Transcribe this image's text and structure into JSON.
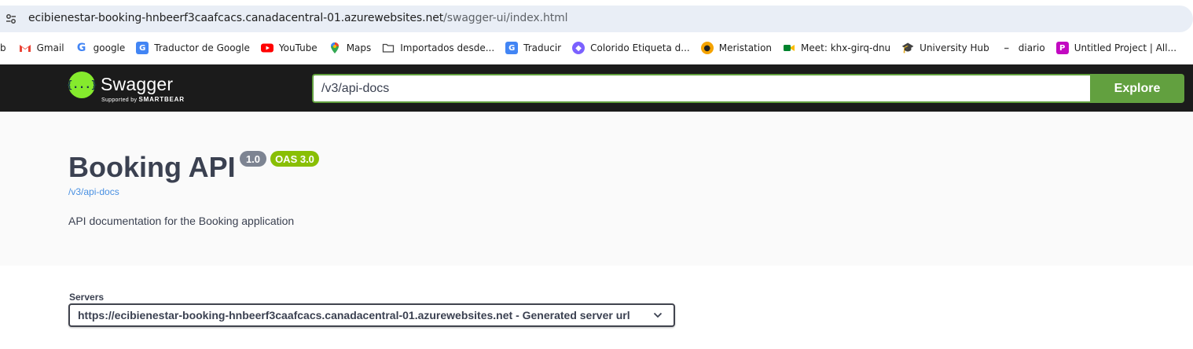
{
  "browser": {
    "url_host": "ecibienestar-booking-hnbeerf3caafcacs.canadacentral-01.azurewebsites.net",
    "url_path": "/swagger-ui/index.html"
  },
  "bookmarks": [
    {
      "label": "b",
      "icon": "truncated"
    },
    {
      "label": "Gmail",
      "icon": "gmail-icon",
      "color": "#ea4335"
    },
    {
      "label": "google",
      "icon": "google-icon",
      "color": "#4285f4"
    },
    {
      "label": "Traductor de Google",
      "icon": "google-translate-icon",
      "color": "#4285f4"
    },
    {
      "label": "YouTube",
      "icon": "youtube-icon",
      "color": "#ff0000"
    },
    {
      "label": "Maps",
      "icon": "maps-pin-icon",
      "color": "#34a853"
    },
    {
      "label": "Importados desde...",
      "icon": "folder-icon"
    },
    {
      "label": "Traducir",
      "icon": "google-translate-icon",
      "color": "#4285f4"
    },
    {
      "label": "Colorido Etiqueta d...",
      "icon": "colorful-label-icon",
      "color": "#7b61ff"
    },
    {
      "label": "Meristation",
      "icon": "meristation-icon",
      "color": "#f5a300"
    },
    {
      "label": "Meet: khx-girq-dnu",
      "icon": "google-meet-icon",
      "color": "#00832d"
    },
    {
      "label": "University Hub",
      "icon": "graduate-icon",
      "color": "#8d6e63"
    },
    {
      "label": "diario",
      "icon": "diario-icon",
      "color": "#555555"
    },
    {
      "label": "Untitled Project | All...",
      "icon": "picsart-icon",
      "color": "#c209c1"
    }
  ],
  "topbar": {
    "logo_text": "Swagger",
    "logo_supported_by": "Supported by",
    "logo_brand": "SMARTBEAR",
    "logo_mark": "{...}",
    "spec_url_value": "/v3/api-docs",
    "explore_label": "Explore",
    "accent": "#62a03f"
  },
  "info": {
    "title": "Booking API",
    "version_badge": "1.0",
    "oas_badge": "OAS 3.0",
    "spec_link": "/v3/api-docs",
    "description": "API documentation for the Booking application"
  },
  "servers": {
    "label": "Servers",
    "selected": "https://ecibienestar-booking-hnbeerf3caafcacs.canadacentral-01.azurewebsites.net - Generated server url"
  }
}
